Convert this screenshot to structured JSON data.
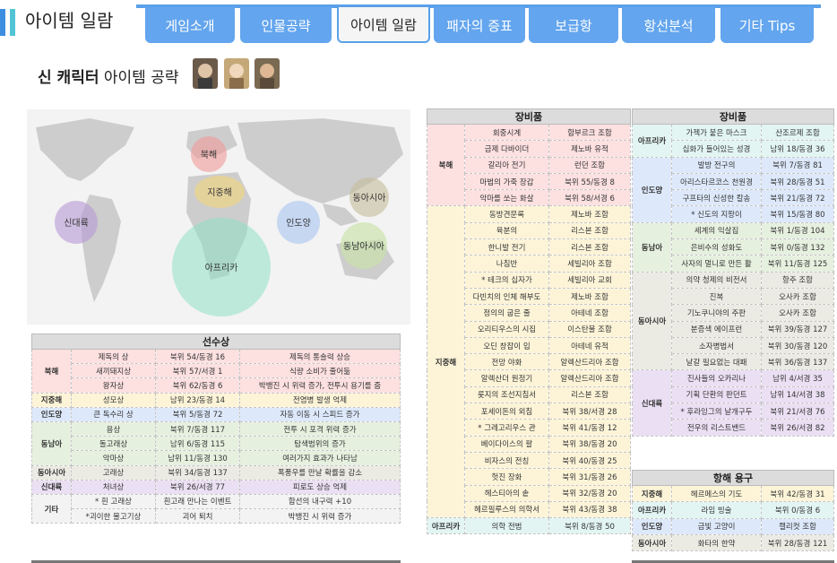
{
  "header": {
    "title": "아이템 일람",
    "tabs": [
      "게임소개",
      "인물공략",
      "아이템 일람",
      "패자의 증표",
      "보급항",
      "항선분석",
      "기타 Tips"
    ]
  },
  "section": {
    "title_bold": "신 캐릭터",
    "title_rest": " 아이템 공략"
  },
  "map": {
    "regions": [
      "북해",
      "지중해",
      "신대륙",
      "인도양",
      "동아시아",
      "동남아시아",
      "아프리카"
    ]
  },
  "ships": {
    "header": "선수상",
    "rows": [
      [
        "북해",
        "제독의 상",
        "북위 54/동경 16",
        "제독의 통솔력 상승"
      ],
      [
        "",
        "새끼돼지상",
        "북위 57/서경 1",
        "식량 소비가 줄어듦"
      ],
      [
        "",
        "왕자상",
        "북위 62/동경 6",
        "박뱅진 시 위력 증가, 전투시 용기를 줌"
      ],
      [
        "지중해",
        "성모상",
        "남위 23/동경 14",
        "전염병 발생 억제"
      ],
      [
        "인도양",
        "큰 독수리 상",
        "북위 5/동경 72",
        "자동 이동 시 스피드 증가"
      ],
      [
        "동남아",
        "용상",
        "북위 7/동경 117",
        "전투 시 포격 위력 증가"
      ],
      [
        "",
        "돌고래상",
        "남위 6/동경 115",
        "탐색범위의 증가"
      ],
      [
        "",
        "악마상",
        "남위 11/동경 130",
        "여러가지 효과가 나타남"
      ],
      [
        "동아시아",
        "고래상",
        "북위 34/동경 137",
        "폭풍우를 만날 확률을 감소"
      ],
      [
        "신대륙",
        "처녀상",
        "북위 26/서경 77",
        "피로도 상승 억제"
      ],
      [
        "기타",
        "* 흰 고래상",
        "흰고래 만나는 이벤트",
        "함선의 내구력 +10"
      ],
      [
        "",
        "*괴이한 물고기상",
        "괴어 퇴치",
        "박뱅진 시 위력 증가"
      ]
    ]
  },
  "equip1": {
    "header": "장비품",
    "rows": [
      [
        "북해",
        "회중시계",
        "함부르크 조합"
      ],
      [
        "",
        "금제 다바이더",
        "제노바 유적"
      ],
      [
        "",
        "갈리아 전기",
        "런던 조합"
      ],
      [
        "",
        "마법의 가죽 장갑",
        "북위 55/동경 8"
      ],
      [
        "",
        "악마를 쏘는 화살",
        "북위 58/서경 6"
      ],
      [
        "지중해",
        "동방견문록",
        "제노바 조합"
      ],
      [
        "",
        "육분의",
        "리스본 조합"
      ],
      [
        "",
        "한니발 전기",
        "리스본 조합"
      ],
      [
        "",
        "나침반",
        "세빌리아 조합"
      ],
      [
        "",
        "* 테크의 십자가",
        "세빌리아 교회"
      ],
      [
        "",
        "다빈치의 인체 해부도",
        "제노바 조합"
      ],
      [
        "",
        "정의의 굽은 줄",
        "아테네 조합"
      ],
      [
        "",
        "오리티우스의 시집",
        "이스탄불 조합"
      ],
      [
        "",
        "오딘 창잡이 입",
        "아테네 유적"
      ],
      [
        "",
        "전망 야화",
        "알렉산드리아 조합"
      ],
      [
        "",
        "알렉산더 원정기",
        "알렉산드리아 조합"
      ],
      [
        "",
        "롯지의 조선지침서",
        "리스본 조합"
      ],
      [
        "",
        "포세이돈의 외침",
        "북위 38/서경 28"
      ],
      [
        "",
        "* 그레고리우스 관",
        "북위 41/동경 12"
      ],
      [
        "",
        "베이다이스의 팔",
        "북위 38/동경 20"
      ],
      [
        "",
        "비자스의 전칭",
        "북위 40/동경 25"
      ],
      [
        "",
        "헛진 장화",
        "북위 31/동경 26"
      ],
      [
        "",
        "헤스티아의 솥",
        "북위 32/동경 20"
      ],
      [
        "",
        "헤르필루스의 의학서",
        "북위 43/동경 38"
      ],
      [
        "아프리카",
        "의학 전범",
        "북위 8/동경 50"
      ]
    ]
  },
  "equip2": {
    "header": "장비품",
    "rows": [
      [
        "아프리카",
        "가젝가 붙은 마스크",
        "산조르제 조합"
      ],
      [
        "",
        "십화가 들어있는 성경",
        "남위 18/동경 36"
      ],
      [
        "인도양",
        "발방 전구의",
        "북위 7/동경 81"
      ],
      [
        "",
        "아리스타르코스 천원경",
        "북위 28/동경 51"
      ],
      [
        "",
        "구프타의 신성한 칼송",
        "북위 21/동경 72"
      ],
      [
        "",
        "* 신도의 지팡이",
        "북위 15/동경 80"
      ],
      [
        "동남아",
        "세계의 익살집",
        "북위 1/동경 104"
      ],
      [
        "",
        "은비수의 성화도",
        "북위 0/동경 132"
      ],
      [
        "",
        "사자의 멀니로 만든 활",
        "북위 11/동경 125"
      ],
      [
        "동아시아",
        "의약 청제의 비전서",
        "항주 조합"
      ],
      [
        "",
        "진복",
        "오사카 조합"
      ],
      [
        "",
        "기노쿠니야의 주판",
        "오사카 조합"
      ],
      [
        "",
        "분증색 에이프런",
        "북위 39/동경 127"
      ],
      [
        "",
        "소자병법서",
        "북위 30/동경 120"
      ],
      [
        "",
        "날갈 필요없는 대패",
        "북위 36/동경 137"
      ],
      [
        "신대륙",
        "진사들의 오카리나",
        "남위 4/서경 35"
      ],
      [
        "",
        "기획 단환의 판던트",
        "남위 14/서경 38"
      ],
      [
        "",
        "* 후라잉그의 날개구두",
        "북위 21/서경 76"
      ],
      [
        "",
        "전우의 리스트밴드",
        "북위 26/서경 82"
      ]
    ]
  },
  "voyage": {
    "header": "항해 용구",
    "rows": [
      [
        "지중해",
        "헤르메스의 기도",
        "북위 42/동경 31"
      ],
      [
        "아프리카",
        "라임 빙술",
        "북위 0/동경 6"
      ],
      [
        "인도양",
        "금빛 고양이",
        "캘리컷 조합"
      ],
      [
        "동아시아",
        "화타의 한약",
        "북위 28/동경 121"
      ]
    ]
  }
}
